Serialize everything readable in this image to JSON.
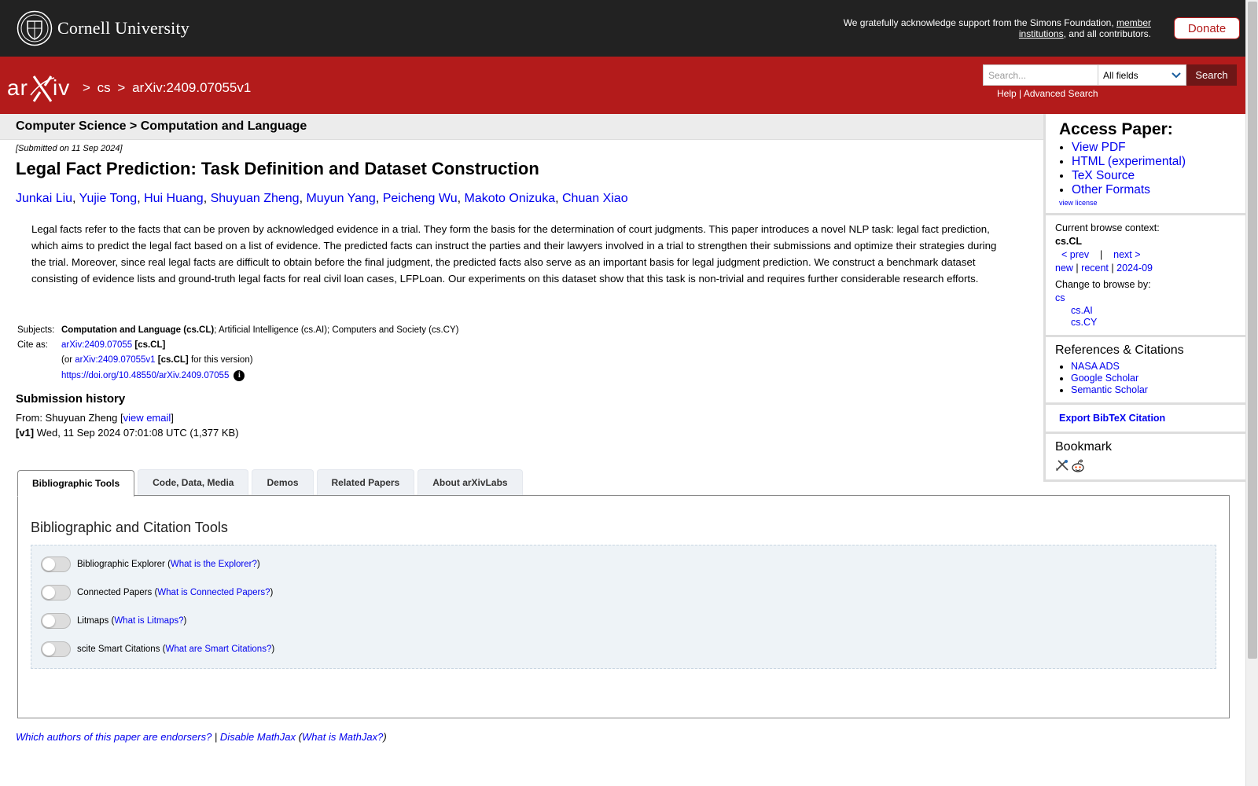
{
  "topbar": {
    "org_name": "Cornell University",
    "support_text_1": "We gratefully acknowledge support from the Simons Foundation, ",
    "support_link": "member institutions",
    "support_text_2": ", and all contributors.",
    "donate_label": "Donate"
  },
  "header": {
    "crumb_sep": ">",
    "crumb_cs": "cs",
    "crumb_id": "arXiv:2409.07055v1",
    "search_placeholder": "Search...",
    "search_field": "All fields",
    "search_label": "Search",
    "help_label": "Help",
    "sep": "|",
    "advanced_label": "Advanced Search"
  },
  "paper": {
    "subject_header": "Computer Science > Computation and Language",
    "dateline": "[Submitted on 11 Sep 2024]",
    "title": "Legal Fact Prediction: Task Definition and Dataset Construction",
    "authors": [
      "Junkai Liu",
      "Yujie Tong",
      "Hui Huang",
      "Shuyuan Zheng",
      "Muyun Yang",
      "Peicheng Wu",
      "Makoto Onizuka",
      "Chuan Xiao"
    ],
    "abstract": "Legal facts refer to the facts that can be proven by acknowledged evidence in a trial. They form the basis for the determination of court judgments. This paper introduces a novel NLP task: legal fact prediction, which aims to predict the legal fact based on a list of evidence. The predicted facts can instruct the parties and their lawyers involved in a trial to strengthen their submissions and optimize their strategies during the trial. Moreover, since real legal facts are difficult to obtain before the final judgment, the predicted facts also serve as an important basis for legal judgment prediction. We construct a benchmark dataset consisting of evidence lists and ground-truth legal facts for real civil loan cases, LFPLoan. Our experiments on this dataset show that this task is non-trivial and requires further considerable research efforts.",
    "subjects_label": "Subjects:",
    "subjects_primary": "Computation and Language (cs.CL)",
    "subjects_rest": "; Artificial Intelligence (cs.AI); Computers and Society (cs.CY)",
    "cite_label": "Cite as:",
    "cite_id": "arXiv:2409.07055",
    "cite_cat": "[cs.CL]",
    "cite_or": "(or ",
    "cite_version": "arXiv:2409.07055v1",
    "cite_cat2": "[cs.CL]",
    "cite_suffix": " for this version)",
    "doi": "https://doi.org/10.48550/arXiv.2409.07055",
    "history_title": "Submission history",
    "from_label": "From: Shuyuan Zheng [",
    "view_email": "view email",
    "from_close": "]",
    "v1_label": "[v1]",
    "v1_text": " Wed, 11 Sep 2024 07:01:08 UTC (1,377 KB)"
  },
  "tabs": [
    "Bibliographic Tools",
    "Code, Data, Media",
    "Demos",
    "Related Papers",
    "About arXivLabs"
  ],
  "tools": {
    "panel_title": "Bibliographic and Citation Tools",
    "items": [
      {
        "label": "Bibliographic Explorer",
        "link": "What is the Explorer?"
      },
      {
        "label": "Connected Papers",
        "link": "What is Connected Papers?"
      },
      {
        "label": "Litmaps",
        "link": "What is Litmaps?"
      },
      {
        "label": "scite Smart Citations",
        "link": "What are Smart Citations?"
      }
    ]
  },
  "footer": {
    "endorsers": "Which authors of this paper are endorsers?",
    "sep": " | ",
    "disable_mathjax": "Disable MathJax",
    "what_mathjax": "What is MathJax?"
  },
  "sidebar": {
    "access_title": "Access Paper:",
    "access_links": [
      "View PDF",
      "HTML (experimental)",
      "TeX Source",
      "Other Formats"
    ],
    "license": "view license",
    "browse_context_label": "Current browse context:",
    "browse_context": "cs.CL",
    "prev": "< prev",
    "pipe": "|",
    "next": "next >",
    "browse_new": "new",
    "browse_recent": "recent",
    "browse_month": "2024-09",
    "change_label": "Change to browse by:",
    "browse_by": [
      "cs",
      "cs.AI",
      "cs.CY"
    ],
    "refs_title": "References & Citations",
    "refs_links": [
      "NASA ADS",
      "Google Scholar",
      "Semantic Scholar"
    ],
    "bibtex": "Export BibTeX Citation",
    "bookmark_title": "Bookmark"
  },
  "colors": {
    "arxiv_red": "#b31b1b",
    "topbar": "#222222",
    "link": "#0000ee"
  }
}
